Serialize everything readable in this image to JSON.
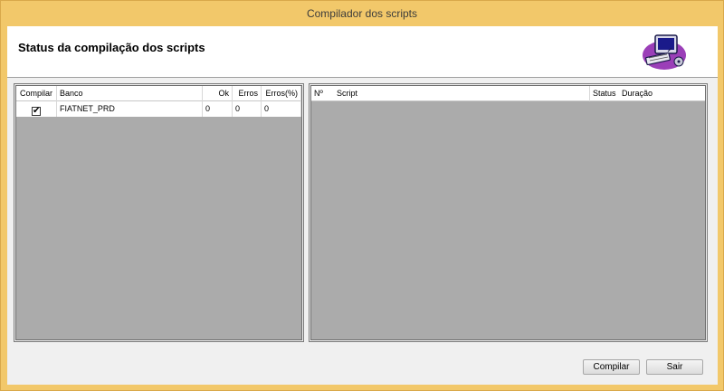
{
  "window": {
    "title": "Compilador dos scripts"
  },
  "header": {
    "title": "Status da compilação dos scripts",
    "logo_icon": "computer-icon"
  },
  "databases_grid": {
    "columns": [
      "Compilar",
      "Banco",
      "Ok",
      "Erros",
      "Erros(%)"
    ],
    "rows": [
      {
        "compilar": "✔",
        "banco": "FIATNET_PRD",
        "ok": "0",
        "erros": "0",
        "erros_pct": "0"
      }
    ]
  },
  "scripts_grid": {
    "columns": [
      "Nº",
      "Script",
      "Status",
      "Duração"
    ],
    "rows": []
  },
  "buttons": {
    "compile": "Compilar",
    "exit": "Sair"
  }
}
